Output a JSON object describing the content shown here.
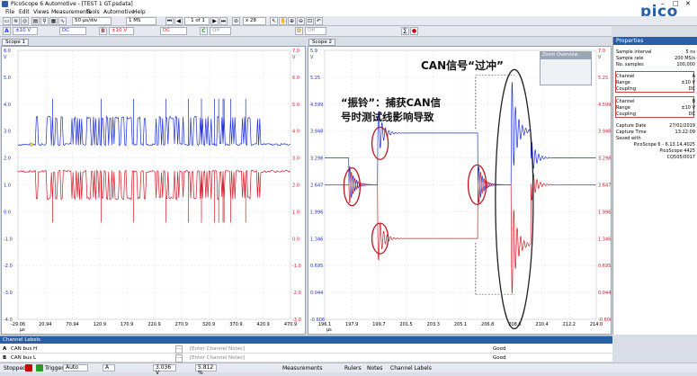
{
  "window": {
    "title": "PicoScope 6 Automotive - [TEST 1 GT.psdata]",
    "controls": [
      "–",
      "□",
      "✕"
    ]
  },
  "logo": "pico",
  "menu": [
    "File",
    "Edit",
    "Views",
    "Measurements",
    "Tools",
    "Automotive",
    "Help"
  ],
  "toolbar": {
    "timebase": "50 µs/div",
    "samples": "1 MS",
    "page": "1 of 1",
    "zoom": "x 28"
  },
  "channel_bar": {
    "ch_a_range": "±10 V",
    "ch_a_coupling": "DC",
    "ch_b_range": "±10 V",
    "ch_b_coupling": "DC",
    "ch_c": "Off",
    "ch_d": "Off"
  },
  "scope1": {
    "tab": "Scope 1",
    "y_top_unit": "V",
    "ch_a_ticks": [
      "6.0",
      "5.0",
      "4.0",
      "3.0",
      "2.0",
      "1.0",
      "0.0",
      "-1.0",
      "-2.0",
      "-3.0",
      "-4.0"
    ],
    "ch_b_ticks": [
      "7.0",
      "6.0",
      "5.0",
      "4.0",
      "3.0",
      "2.0",
      "1.0",
      "0.0",
      "-1.0",
      "-2.0",
      "-3.0"
    ],
    "x_ticks": [
      "-29.06",
      "20.94",
      "70.94",
      "120.9",
      "170.9",
      "220.9",
      "270.9",
      "320.9",
      "370.9",
      "420.9",
      "470.9"
    ],
    "x_unit": "µs",
    "x_left_label": "-4.0",
    "x_right_label": "-3.0"
  },
  "scope2": {
    "tab": "Scope 2",
    "zoom_overview": "Zoom Overview",
    "y_top_unit": "V",
    "ch_a_ticks": [
      "5.9",
      "5.25",
      "4.599",
      "3.948",
      "3.298",
      "2.647",
      "1.996",
      "1.346",
      "0.695",
      "0.044",
      "-0.606"
    ],
    "ch_b_ticks": [
      "7.0",
      "5.25",
      "4.599",
      "3.948",
      "3.298",
      "2.647",
      "1.996",
      "1.346",
      "0.695",
      "0.044",
      "-0.606"
    ],
    "x_ticks": [
      "196.1",
      "197.9",
      "199.7",
      "201.5",
      "203.3",
      "205.1",
      "206.8",
      "208.6",
      "210.4",
      "212.2",
      "214.0"
    ],
    "x_unit": "µs"
  },
  "annotations": {
    "overshoot": "CAN信号“过冲”",
    "ringing_line1": "“振铃”：捕获CAN信",
    "ringing_line2": "号时测试线影响导致"
  },
  "properties": {
    "header": "Properties",
    "rows": [
      {
        "k": "Sample interval",
        "v": "5 ns"
      },
      {
        "k": "Sample rate",
        "v": "200 MS/s"
      },
      {
        "k": "No. samples",
        "v": "100,000"
      }
    ],
    "channel_a": [
      {
        "k": "Channel",
        "v": "A"
      },
      {
        "k": "Range",
        "v": "±10 V"
      },
      {
        "k": "Coupling",
        "v": "DC"
      }
    ],
    "channel_b": [
      {
        "k": "Channel",
        "v": "B"
      },
      {
        "k": "Range",
        "v": "±10 V"
      },
      {
        "k": "Coupling",
        "v": "DC"
      }
    ],
    "capture": [
      {
        "k": "Capture Date",
        "v": "27/01/2019"
      },
      {
        "k": "Capture Time",
        "v": "13:22:09"
      }
    ],
    "saved_with": "Saved with",
    "software": "PicoScope 6 - 6.13.14.4025",
    "device": "PicoScope 4425",
    "serial": "CQ505/0017"
  },
  "channel_labels": {
    "header": "Channel Labels",
    "rows": [
      {
        "ch": "A",
        "name": "CAN bus H",
        "notes": "[Enter Channel Notes]",
        "status": "Good"
      },
      {
        "ch": "B",
        "name": "CAN bus L",
        "notes": "[Enter Channel Notes]",
        "status": "Good"
      }
    ]
  },
  "status": {
    "state": "Stopped",
    "trigger": "Trigger",
    "mode": "Auto",
    "channel": "A",
    "level": "3.036 V",
    "pre": "5.812 %",
    "measurements": "Measurements",
    "rulers": "Rulers",
    "notes": "Notes",
    "channel_labels": "Channel Labels"
  },
  "colors": {
    "ch_a": "#1f2fd4",
    "ch_b": "#d51a29",
    "accent": "#2a5fa8"
  }
}
